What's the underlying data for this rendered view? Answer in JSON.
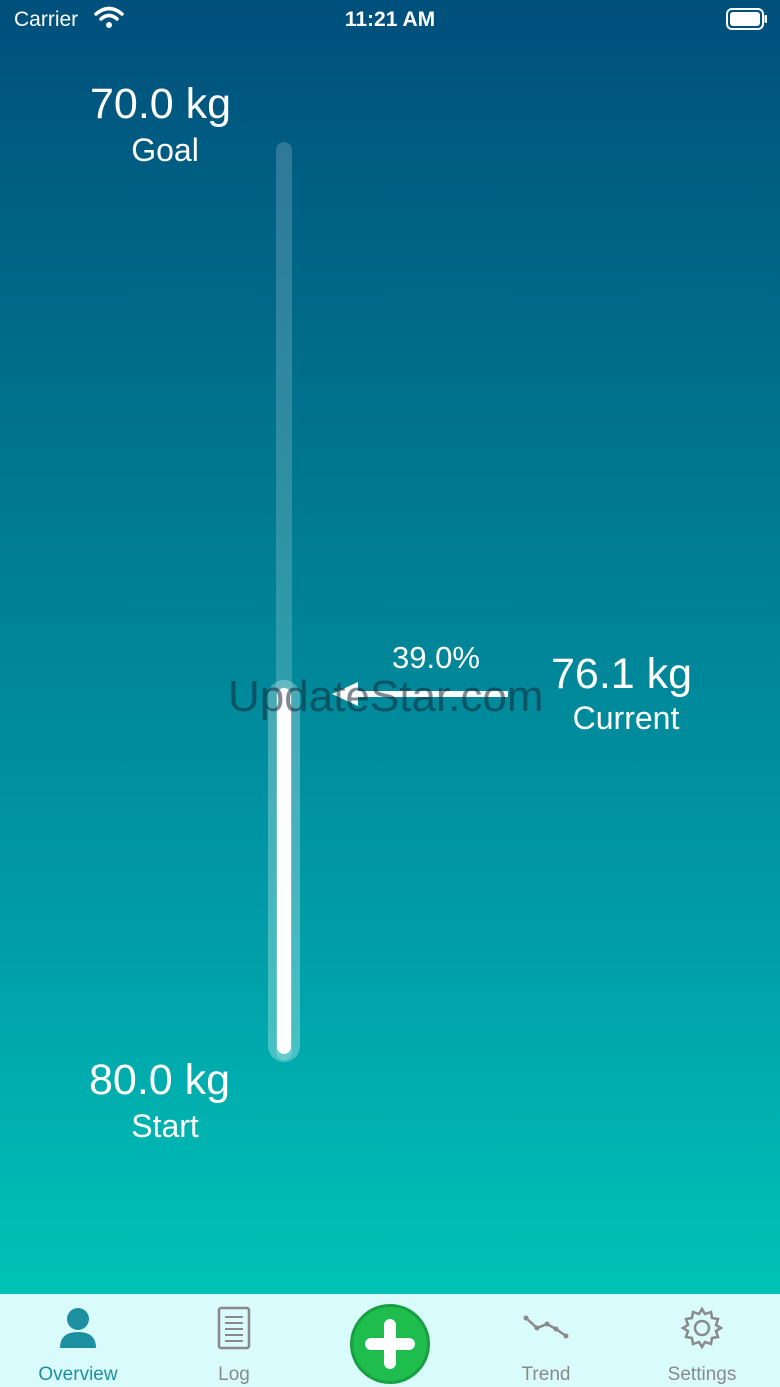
{
  "status_bar": {
    "carrier": "Carrier",
    "time": "11:21 AM"
  },
  "progress": {
    "goal_value": "70.0 kg",
    "goal_label": "Goal",
    "start_value": "80.0 kg",
    "start_label": "Start",
    "current_value": "76.1 kg",
    "current_label": "Current",
    "percent_text": "39.0%",
    "fraction_complete": 0.39
  },
  "watermark": "UpdateStar.com",
  "tabbar": {
    "tabs": [
      {
        "label": "Overview",
        "icon": "person-icon",
        "active": true
      },
      {
        "label": "Log",
        "icon": "document-icon"
      },
      {
        "label": "",
        "icon": "plus-icon"
      },
      {
        "label": "Trend",
        "icon": "trend-icon"
      },
      {
        "label": "Settings",
        "icon": "gear-icon"
      }
    ]
  },
  "colors": {
    "accent": "#1c8fa0",
    "add_button": "#1fbc4e",
    "tabbar_bg": "#d9fbfb",
    "gradient_top": "#004f7c",
    "gradient_bottom": "#00c1b6"
  }
}
